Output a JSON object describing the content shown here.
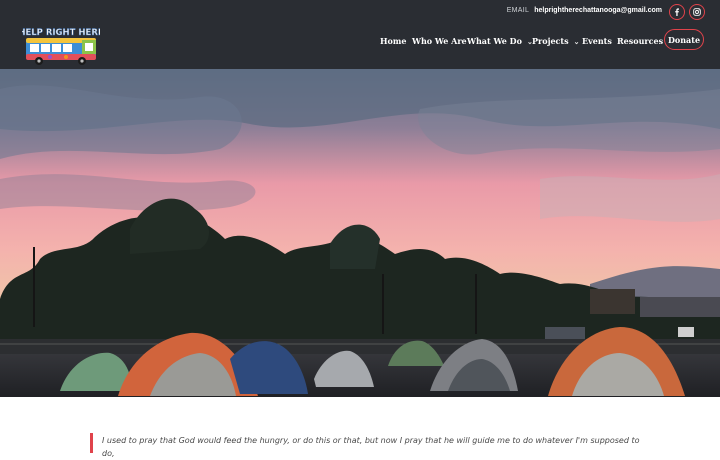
{
  "topbar": {
    "email_label": "EMAIL",
    "email_value": "helprightherechattanooga@gmail.com",
    "social": [
      {
        "name": "facebook",
        "glyph": "f"
      },
      {
        "name": "instagram",
        "glyph": "ig"
      }
    ]
  },
  "logo": {
    "text": "HELP RIGHT HERE",
    "kind": "painted bus logo"
  },
  "nav": {
    "items": [
      {
        "label": "Home",
        "dropdown": false
      },
      {
        "label": "Who We Are",
        "dropdown": false
      },
      {
        "label": "What We Do",
        "dropdown": true
      },
      {
        "label": "Projects",
        "dropdown": true
      },
      {
        "label": "Events",
        "dropdown": false
      },
      {
        "label": "Resources",
        "dropdown": false
      }
    ],
    "donate_label": "Donate",
    "chevron": "⌄"
  },
  "quote": {
    "text": "I used to pray that God would feed the hungry, or do this or that, but now I pray that he will guide me to do whatever I'm supposed to do,"
  },
  "colors": {
    "header_bg": "#2a2d33",
    "accent": "#e0434b",
    "text_dark": "#4a4a4a"
  }
}
